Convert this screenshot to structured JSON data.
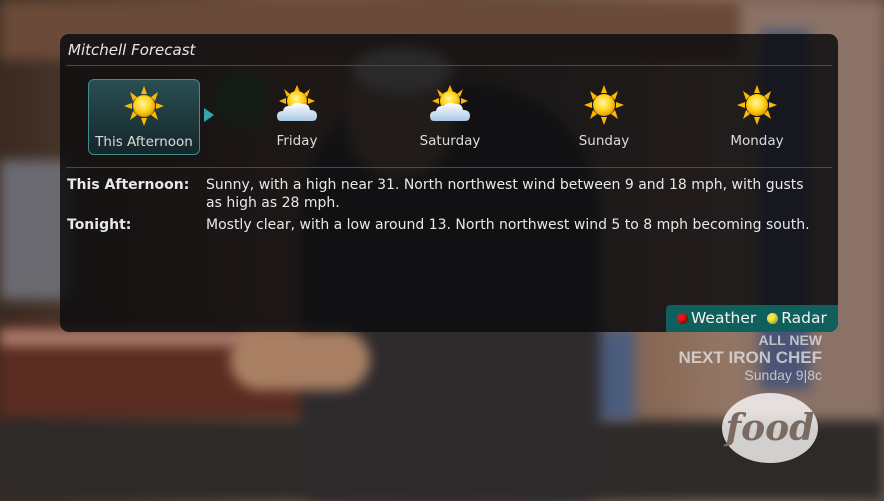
{
  "panel": {
    "title": "Mitchell Forecast"
  },
  "days": [
    {
      "label": "This Afternoon",
      "icon": "sunny-icon",
      "selected": true
    },
    {
      "label": "Friday",
      "icon": "partly-cloudy-icon",
      "selected": false
    },
    {
      "label": "Saturday",
      "icon": "partly-cloudy-icon",
      "selected": false
    },
    {
      "label": "Sunday",
      "icon": "sunny-icon",
      "selected": false
    },
    {
      "label": "Monday",
      "icon": "sunny-icon",
      "selected": false
    }
  ],
  "forecast": [
    {
      "label": "This Afternoon:",
      "text": "Sunny, with a high near 31. North northwest wind between 9 and 18 mph, with gusts as high as 28 mph."
    },
    {
      "label": "Tonight:",
      "text": "Mostly clear, with a low around 13. North northwest wind 5 to 8 mph becoming south."
    }
  ],
  "legend": {
    "weather_label": "Weather",
    "weather_color": "#e01818",
    "radar_label": "Radar",
    "radar_color": "#f2e64a"
  },
  "promo": {
    "line1": "ALL NEW",
    "line2": "NEXT IRON CHEF",
    "line3": "Sunday 9|8c"
  },
  "channel_logo": "food",
  "colors": {
    "selection_border": "#3f8e8a",
    "legend_bg": "#0f5f5c"
  }
}
